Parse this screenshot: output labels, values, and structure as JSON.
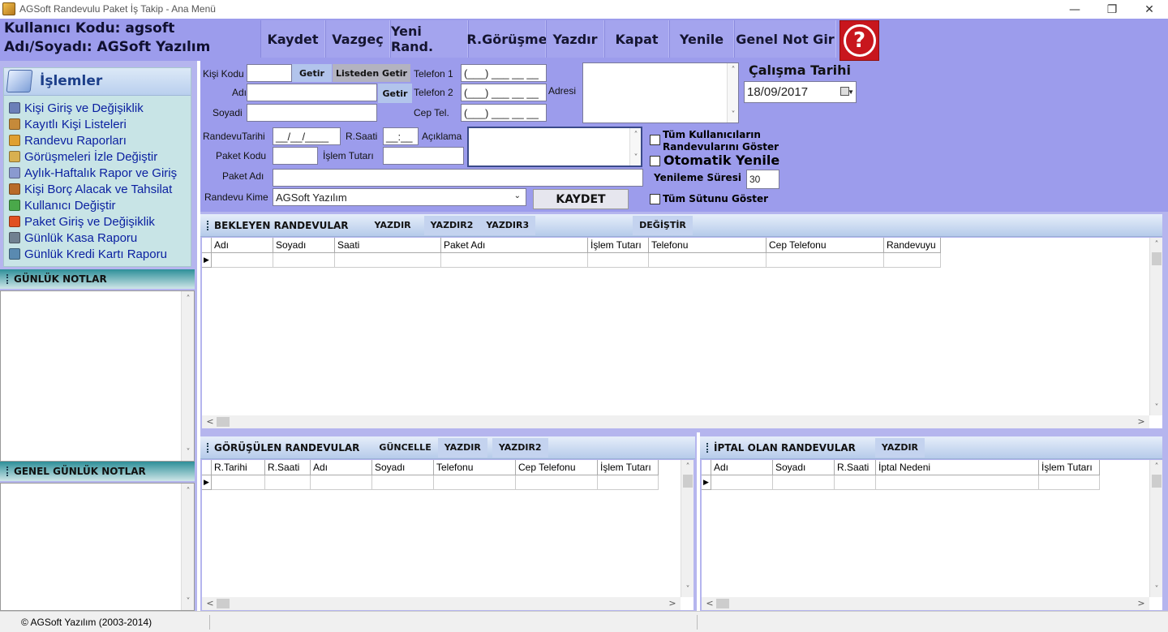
{
  "window": {
    "title": "AGSoft Randevulu Paket İş Takip - Ana Menü",
    "minimize": "—",
    "restore": "❐",
    "close": "✕"
  },
  "header": {
    "user_code": "Kullanıcı Kodu: agsoft",
    "user_name": "Adı/Soyadı: AGSoft Yazılım",
    "toolbar": [
      "Kaydet",
      "Vazgeç",
      "Yeni Rand.",
      "R.Görüşme",
      "Yazdır",
      "Kapat",
      "Yenile",
      "Genel Not Gir"
    ],
    "help": "?"
  },
  "sidebar": {
    "title": "İşlemler",
    "items": [
      {
        "label": "Kişi Giriş ve Değişiklik",
        "icon_color": "#6b7fb8"
      },
      {
        "label": "Kayıtlı Kişi Listeleri",
        "icon_color": "#c58a3a"
      },
      {
        "label": "Randevu Raporları",
        "icon_color": "#e0a030"
      },
      {
        "label": "Görüşmeleri İzle Değiştir",
        "icon_color": "#d8b050"
      },
      {
        "label": "Aylık-Haftalık Rapor ve Giriş",
        "icon_color": "#8a9ad0"
      },
      {
        "label": "Kişi Borç Alacak ve Tahsilat",
        "icon_color": "#b86b2a"
      },
      {
        "label": "Kullanıcı Değiştir",
        "icon_color": "#4aa84a"
      },
      {
        "label": "Paket Giriş ve Değişiklik",
        "icon_color": "#e05020"
      },
      {
        "label": "Günlük Kasa Raporu",
        "icon_color": "#708090"
      },
      {
        "label": "Günlük Kredi Kartı Raporu",
        "icon_color": "#5a8ab0"
      }
    ],
    "daily_notes": "GÜNLÜK NOTLAR",
    "general_notes": "GENEL GÜNLÜK NOTLAR",
    "scroll_up": "˄",
    "scroll_down": "˅"
  },
  "form": {
    "kisi_kodu_label": "Kişi Kodu",
    "getir": "Getir",
    "listeden_getir": "Listeden Getir",
    "adi_label": "Adı",
    "soyadi_label": "Soyadi",
    "telefon1_label": "Telefon 1",
    "telefon2_label": "Telefon 2",
    "cep_label": "Cep Tel.",
    "phone_mask": "(___) ___ __ __",
    "adresi_label": "Adresi",
    "calisma_tarihi_label": "Çalışma Tarihi",
    "calisma_tarihi": "18/09/2017",
    "randevu_tarihi_label": "RandevuTarihi",
    "date_mask": "__/__/____",
    "rsaati_label": "R.Saati",
    "time_mask": "__:__",
    "aciklama_label": "Açıklama",
    "paket_kodu_label": "Paket Kodu",
    "islem_tutari_label": "İşlem Tutarı",
    "paket_adi_label": "Paket Adı",
    "randevu_kime_label": "Randevu Kime",
    "randevu_kime": "AGSoft Yazılım",
    "kaydet": "KAYDET",
    "tum_kullanicilar": "Tüm Kullanıcıların Randevularını Göster",
    "otomatik_yenile": "Otomatik Yenile",
    "yenileme_suresi_label": "Yenileme Süresi",
    "yenileme_suresi": "30",
    "tum_sutunu": "Tüm Sütunu Göster"
  },
  "bekleyen": {
    "title": "BEKLEYEN RANDEVULAR",
    "buttons": [
      "YAZDIR",
      "YAZDIR2",
      "YAZDIR3"
    ],
    "degistir": "DEĞİŞTİR",
    "columns": [
      "Adı",
      "Soyadı",
      "Saati",
      "Paket Adı",
      "İşlem Tutarı",
      "Telefonu",
      "Cep Telefonu",
      "Randevuyu"
    ]
  },
  "gorusulen": {
    "title": "GÖRÜŞÜLEN RANDEVULAR",
    "buttons": [
      "GÜNCELLE",
      "YAZDIR",
      "YAZDIR2"
    ],
    "columns": [
      "R.Tarihi",
      "R.Saati",
      "Adı",
      "Soyadı",
      "Telefonu",
      "Cep Telefonu",
      "İşlem Tutarı"
    ]
  },
  "iptal": {
    "title": "İPTAL OLAN RANDEVULAR",
    "buttons": [
      "YAZDIR"
    ],
    "columns": [
      "Adı",
      "Soyadı",
      "R.Saati",
      "İptal Nedeni",
      "İşlem Tutarı"
    ]
  },
  "grid_glyphs": {
    "row_indicator": "▶",
    "left": "<",
    "right": ">",
    "up": "˄",
    "down": "˅"
  },
  "status": {
    "copyright": "© AGSoft Yazılım (2003-2014)"
  }
}
